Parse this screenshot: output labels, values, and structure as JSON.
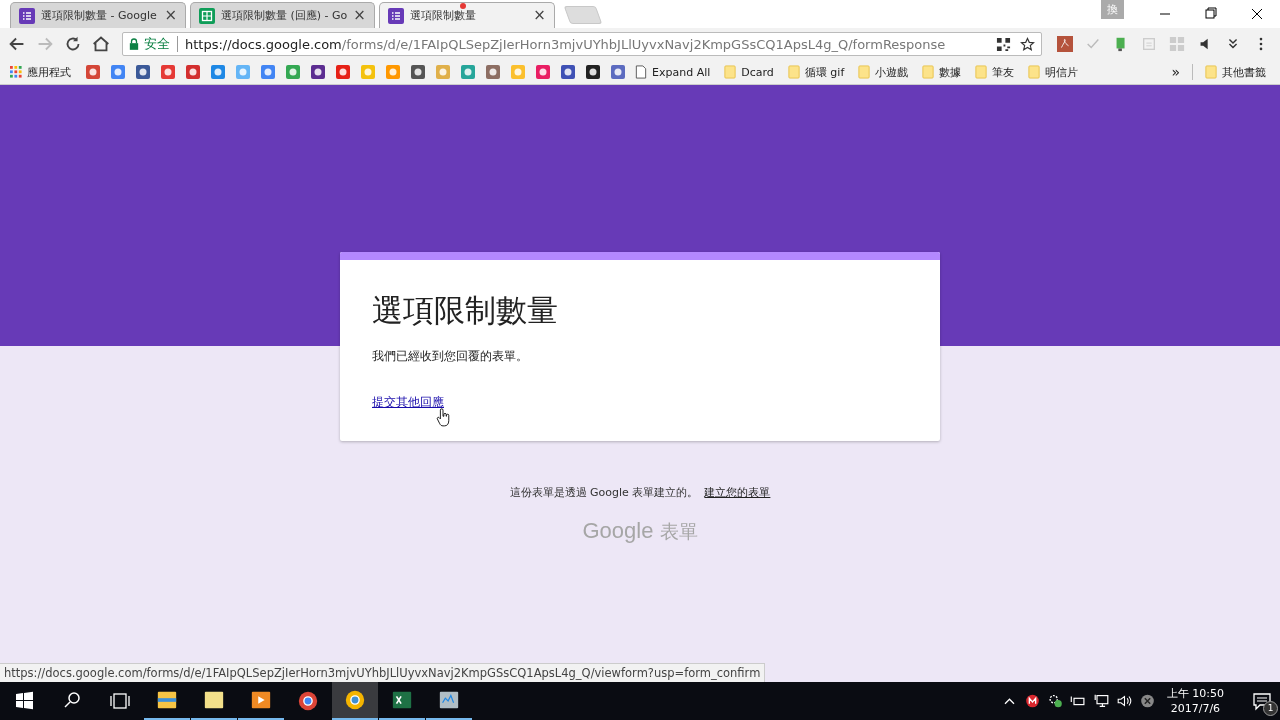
{
  "tabs": [
    {
      "kind": "form",
      "title": "選項限制數量 - Google",
      "selected": false,
      "close": "×"
    },
    {
      "kind": "sheet",
      "title": "選項限制數量 (回應) - Go",
      "selected": false,
      "close": "×"
    },
    {
      "kind": "form",
      "title": "選項限制數量",
      "selected": true,
      "close": "×",
      "alert": true
    }
  ],
  "ime_indicator": "換",
  "address": {
    "security": "安全",
    "origin": "https://docs.google.com",
    "path": "/forms/d/e/1FAIpQLSepZjIerHorn3mjvUYhbJLlUyvxNavj2KmpGSsCQ1ApsL4g_Q/formResponse"
  },
  "bookmarks": {
    "apps": "應用程式",
    "page": "Expand All",
    "folders": [
      "Dcard",
      "循環 gif",
      "小遊戲",
      "數據",
      "筆友",
      "明信片"
    ],
    "more": "»",
    "other": "其他書籤"
  },
  "card": {
    "title": "選項限制數量",
    "message": "我們已經收到您回覆的表單。",
    "link": "提交其他回應"
  },
  "footer": {
    "text": "這份表單是透過 Google 表單建立的。",
    "link": "建立您的表單",
    "logo_word": "Google",
    "logo_product": "表單"
  },
  "status_url": "https://docs.google.com/forms/d/e/1FAIpQLSepZjIerHorn3mjvUYhbJLlUyvxNavj2KmpGSsCQ1ApsL4g_Q/viewform?usp=form_confirm",
  "taskbar": {
    "apps": [
      {
        "kind": "explorer",
        "open": true,
        "selected": false
      },
      {
        "kind": "notes",
        "open": true,
        "selected": false
      },
      {
        "kind": "media",
        "open": true,
        "selected": false
      },
      {
        "kind": "chrome",
        "open": false,
        "selected": false
      },
      {
        "kind": "canary",
        "open": true,
        "selected": true
      },
      {
        "kind": "excel",
        "open": true,
        "selected": false
      },
      {
        "kind": "monitor",
        "open": true,
        "selected": false
      }
    ],
    "time": "上午 10:50",
    "date": "2017/7/6",
    "notifications": "1"
  }
}
